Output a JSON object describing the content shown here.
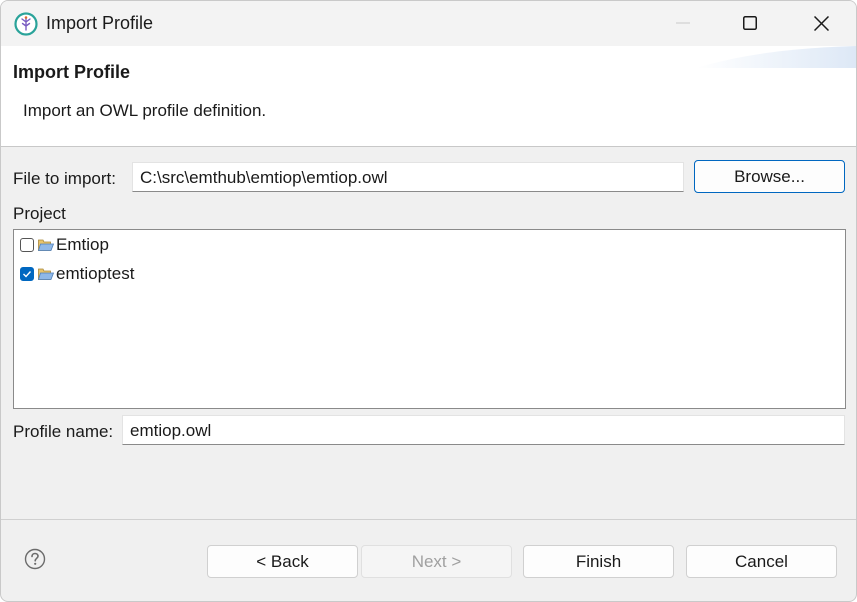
{
  "window": {
    "title": "Import Profile"
  },
  "banner": {
    "title": "Import Profile",
    "description": "Import an OWL profile definition."
  },
  "form": {
    "file_label": "File to import:",
    "file_value": "C:\\src\\emthub\\emtiop\\emtiop.owl",
    "browse_label": "Browse...",
    "project_label": "Project",
    "projects": [
      {
        "name": "Emtiop",
        "checked": false
      },
      {
        "name": "emtioptest",
        "checked": true
      }
    ],
    "profile_name_label": "Profile name:",
    "profile_name_value": "emtiop.owl"
  },
  "footer": {
    "back_label": "< Back",
    "next_label": "Next >",
    "finish_label": "Finish",
    "cancel_label": "Cancel"
  },
  "colors": {
    "accent": "#0067c0",
    "window_bg": "#f0f0f0",
    "disabled_text": "#a0a0a0"
  },
  "icons": {
    "app": "app-logo-icon",
    "minimize": "minimize-icon",
    "maximize": "maximize-icon",
    "close": "close-icon",
    "folder": "open-folder-icon",
    "help": "help-icon"
  }
}
